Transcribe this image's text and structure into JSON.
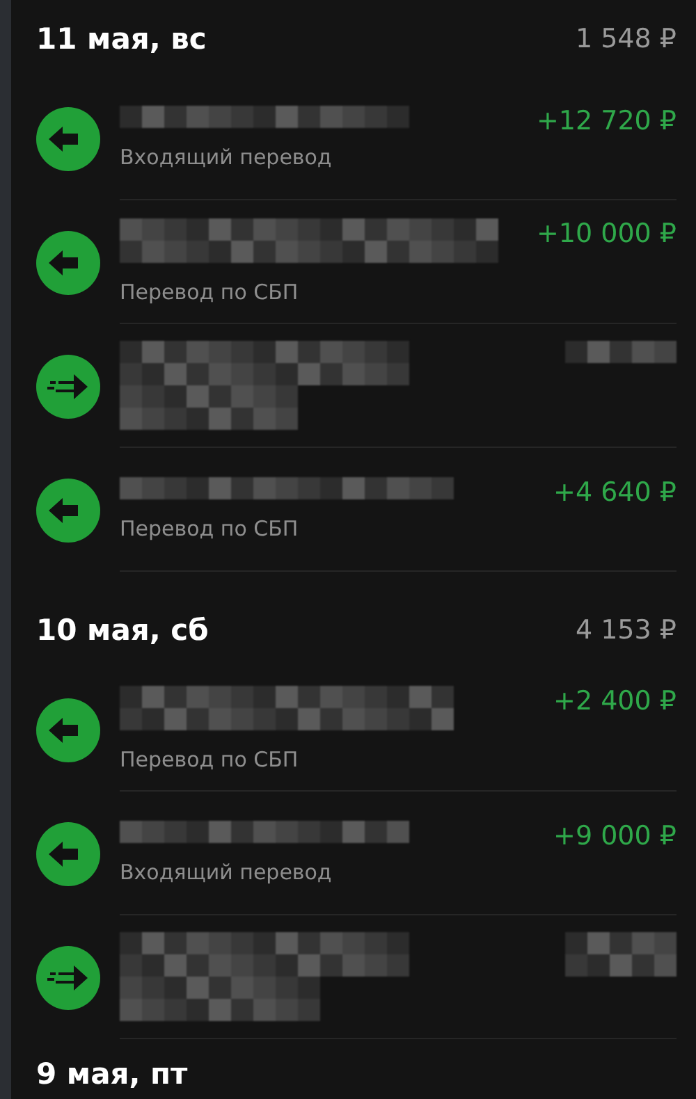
{
  "days": [
    {
      "date": "11 мая, вс",
      "total": "1 548 ₽",
      "transactions": [
        {
          "kind": "incoming",
          "name_redacted": true,
          "subtitle": "Входящий перевод",
          "amount": "+12 720 ₽"
        },
        {
          "kind": "incoming",
          "name_redacted": true,
          "subtitle": "Перевод по СБП",
          "amount": "+10 000 ₽"
        },
        {
          "kind": "outgoing",
          "name_redacted": true,
          "amount_redacted": true
        },
        {
          "kind": "incoming",
          "name_redacted": true,
          "subtitle": "Перевод по СБП",
          "amount": "+4 640 ₽"
        }
      ]
    },
    {
      "date": "10 мая, сб",
      "total": "4 153 ₽",
      "transactions": [
        {
          "kind": "incoming",
          "name_redacted": true,
          "subtitle": "Перевод по СБП",
          "amount": "+2 400 ₽"
        },
        {
          "kind": "incoming",
          "name_redacted": true,
          "subtitle": "Входящий перевод",
          "amount": "+9 000 ₽"
        },
        {
          "kind": "outgoing",
          "name_redacted": true,
          "amount_redacted": true
        }
      ]
    },
    {
      "date": "9 мая, пт"
    }
  ]
}
